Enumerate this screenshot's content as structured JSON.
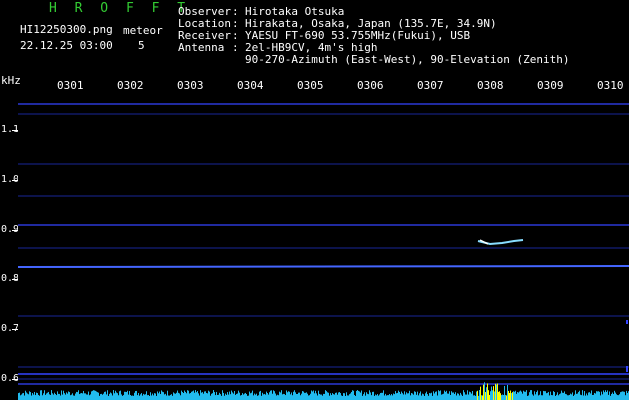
{
  "header": {
    "app_name": "H R O F F T",
    "filename": "HI12250300.png",
    "datetime": "22.12.25 03:00",
    "meteor_label": "meteor",
    "meteor_count": "5"
  },
  "station": {
    "observer_key": "Observer",
    "observer_value": "Hirotaka Otsuka",
    "location_key": "Location",
    "location_value": "Hirakata, Osaka, Japan (135.7E, 34.9N)",
    "receiver_key": "Receiver",
    "receiver_value": "YAESU FT-690 53.755MHz(Fukui), USB",
    "antenna_key": "Antenna",
    "antenna_value": "2el-HB9CV, 4m's high",
    "antenna_value2": "90-270-Azimuth (East-West), 90-Elevation (Zenith)",
    "sep": ":"
  },
  "axis": {
    "y_unit": "kHz",
    "x_ticks": [
      "0301",
      "0302",
      "0303",
      "0304",
      "0305",
      "0306",
      "0307",
      "0308",
      "0309",
      "0310"
    ],
    "y_ticks": [
      "1.1",
      "1.0",
      "0.9",
      "0.8",
      "0.7",
      "0.6"
    ]
  },
  "colors": {
    "logo": "#33cc33",
    "text": "#ffffff",
    "signal_line": "#3344ff",
    "meteor": "#88ddff",
    "noise": "#22bbee",
    "noise_peak": "#ffff00"
  }
}
